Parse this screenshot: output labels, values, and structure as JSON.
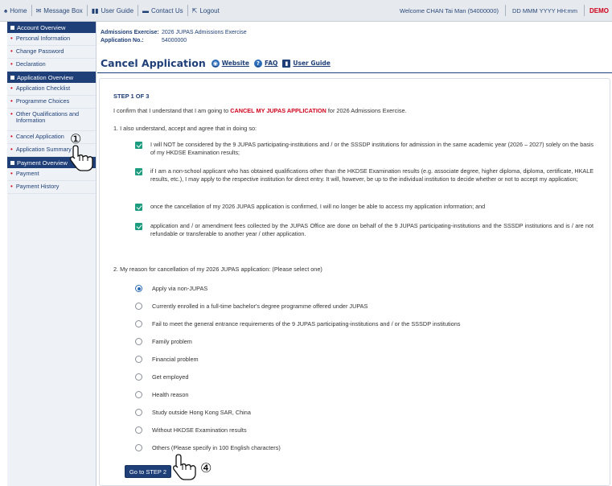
{
  "topbar": {
    "items": [
      {
        "icon": "home-icon",
        "glyph": "♠",
        "label": "Home"
      },
      {
        "icon": "message-icon",
        "glyph": "✉",
        "label": "Message Box"
      },
      {
        "icon": "book-icon",
        "glyph": "▮▮",
        "label": "User Guide"
      },
      {
        "icon": "chat-icon",
        "glyph": "▬",
        "label": "Contact Us"
      },
      {
        "icon": "logout-icon",
        "glyph": "⇱",
        "label": "Logout"
      }
    ],
    "welcome": "Welcome CHAN Tai Man (54000000)",
    "datetime": "DD MMM YYYY HH:mm",
    "demo": "DEMO"
  },
  "sidebar": {
    "sections": [
      {
        "title": "Account Overview",
        "items": [
          "Personal Information",
          "Change Password",
          "Declaration"
        ]
      },
      {
        "title": "Application Overview",
        "items": [
          "Application Checklist",
          "Programme Choices",
          "Other Qualifications and Information",
          "Cancel Application",
          "Application Summary"
        ]
      },
      {
        "title": "Payment Overview",
        "items": [
          "Payment",
          "Payment History"
        ]
      }
    ]
  },
  "info": {
    "exercise_label": "Admissions Exercise:",
    "exercise_value": "2026 JUPAS Admissions Exercise",
    "appno_label": "Application No.:",
    "appno_value": "54000000"
  },
  "page": {
    "title": "Cancel Application",
    "links": [
      {
        "icon": "globe-icon",
        "label": "Website"
      },
      {
        "icon": "faq-icon",
        "label": "FAQ"
      },
      {
        "icon": "book-icon",
        "label": "User Guide"
      }
    ]
  },
  "form": {
    "step": "STEP 1 OF 3",
    "confirm_pre": "I confirm that I understand that I am going to ",
    "confirm_red": "CANCEL MY JUPAS APPLICATION",
    "confirm_post": " for 2026 Admissions Exercise.",
    "p1": "1. I also understand, accept and agree that in doing so:",
    "checks": [
      "I will NOT be considered by the 9 JUPAS participating-institutions and / or the SSSDP institutions for admission in the same academic year (2026 – 2027) solely on the basis of my HKDSE Examination results;",
      "if I am a non-school applicant who has obtained qualifications other than the HKDSE Examination results (e.g. associate degree, higher diploma, diploma, certificate, HKALE results, etc.), I may apply to the respective institution for direct entry. It will, however, be up to the individual institution to decide whether or not to accept my application;",
      "once the cancellation of my 2026 JUPAS application is confirmed, I will no longer be able to access my application information; and",
      "application and / or amendment fees collected by the JUPAS Office are done on behalf of the 9 JUPAS participating-institutions and the SSSDP institutions and is / are not refundable or transferable to another year / other application."
    ],
    "p2": "2. My reason for cancellation of my 2026 JUPAS application: (Please select one)",
    "reasons": [
      "Apply via non-JUPAS",
      "Currently enrolled in a full-time bachelor's degree programme offered under JUPAS",
      "Fail to meet the general entrance requirements of the 9 JUPAS participating-institutions and / or the SSSDP institutions",
      "Family problem",
      "Financial problem",
      "Get employed",
      "Health reason",
      "Study outside Hong Kong SAR, China",
      "Without HKDSE Examination results",
      "Others (Please specify in 100 English characters)"
    ],
    "selected_reason_index": 0,
    "next_button": "Go to STEP 2"
  },
  "markers": {
    "m1": "①",
    "m4": "④"
  },
  "colors": {
    "navy": "#1f3f78",
    "red": "#d0021b",
    "check": "#1e9c7f"
  }
}
